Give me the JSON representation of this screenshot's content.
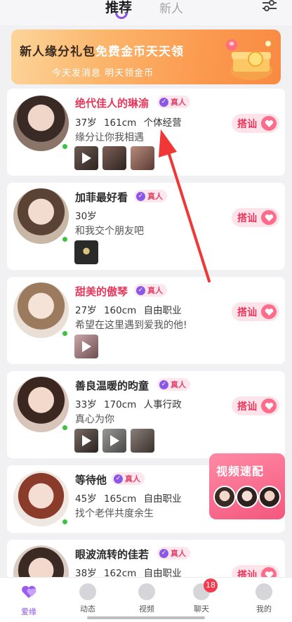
{
  "tabs": {
    "active": "推荐",
    "other": "新人"
  },
  "banner": {
    "title_part1": "新人缘分礼包",
    "title_part2": "免费金币天天领",
    "subtitle": "今天发消息  明天领金币"
  },
  "verified_label": "真人",
  "greet_label": "搭讪",
  "profiles": [
    {
      "name": "绝代佳人的琳渝",
      "meta": "37岁 161cm 个体经营",
      "motto": "缘分让你我相遇"
    },
    {
      "name": "加菲最好看",
      "meta": "30岁",
      "motto": "和我交个朋友吧"
    },
    {
      "name": "甜美的傲琴",
      "meta": "27岁 160cm 自由职业",
      "motto": "希望在这里遇到爱我的他!"
    },
    {
      "name": "善良温暖的昀童",
      "meta": "33岁 170cm 人事行政",
      "motto": "真心为你"
    },
    {
      "name": "等待他",
      "meta": "45岁 165cm 自由职业",
      "motto": "找个老伴共度余生"
    },
    {
      "name": "眼波流转的佳若",
      "meta": "38岁 162cm 自由职业",
      "motto": ""
    }
  ],
  "video_match": {
    "label": "视频速配"
  },
  "nav": {
    "items": [
      {
        "label": "爱缘"
      },
      {
        "label": "动态"
      },
      {
        "label": "视频"
      },
      {
        "label": "聊天"
      },
      {
        "label": "我的"
      }
    ],
    "chat_badge": "18"
  },
  "colors": {
    "accent": "#8a53e8",
    "pink": "#e8365b",
    "online": "#3fc241"
  }
}
